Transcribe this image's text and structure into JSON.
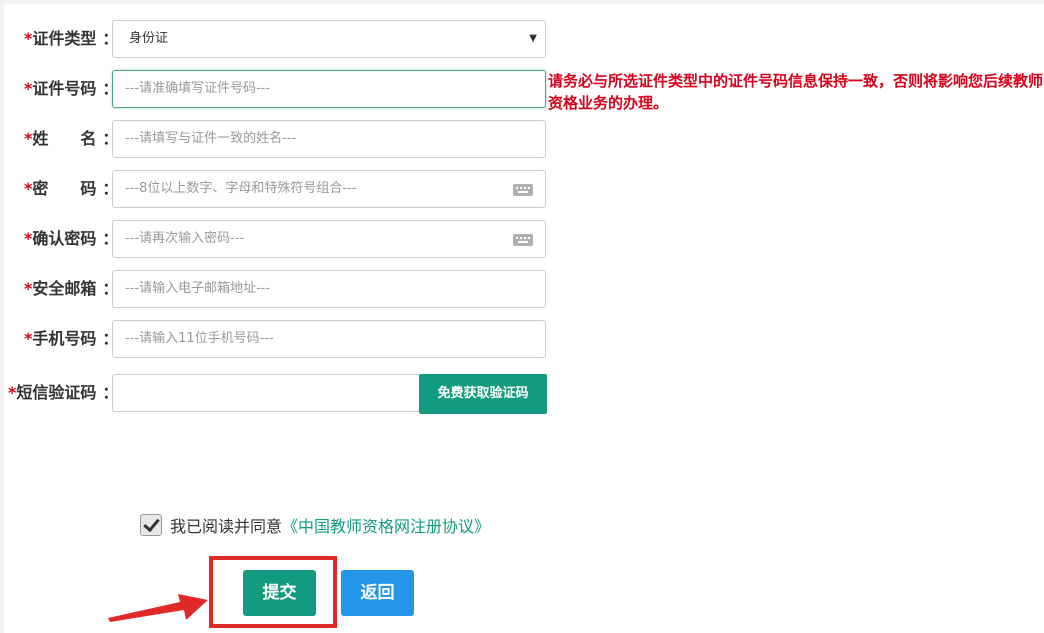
{
  "form": {
    "fields": [
      {
        "label": "证件类型",
        "value": "身份证",
        "placeholder": ""
      },
      {
        "label": "证件号码",
        "value": "",
        "placeholder": "---请准确填写证件号码---"
      },
      {
        "label_a": "姓",
        "label_b": "名",
        "value": "",
        "placeholder": "---请填写与证件一致的姓名---"
      },
      {
        "label_a": "密",
        "label_b": "码",
        "value": "",
        "placeholder": "---8位以上数字、字母和特殊符号组合---"
      },
      {
        "label": "确认密码",
        "value": "",
        "placeholder": "---请再次输入密码---"
      },
      {
        "label": "安全邮箱",
        "value": "",
        "placeholder": "---请输入电子邮箱地址---"
      },
      {
        "label": "手机号码",
        "value": "",
        "placeholder": "---请输入11位手机号码---"
      },
      {
        "label": "短信验证码",
        "value": "",
        "placeholder": ""
      }
    ],
    "required_mark": "*",
    "colon": "：",
    "sms_button": "免费获取验证码",
    "warning": "请务必与所选证件类型中的证件号码信息保持一致，否则将影响您后续教师资格业务的办理。"
  },
  "agreement": {
    "checked": true,
    "text": "我已阅读并同意",
    "link": "《中国教师资格网注册协议》"
  },
  "actions": {
    "submit": "提交",
    "back": "返回"
  },
  "colors": {
    "primary": "#139b7f",
    "secondary": "#2396e8",
    "required": "#d9001b",
    "highlight": "#e02a2a"
  }
}
